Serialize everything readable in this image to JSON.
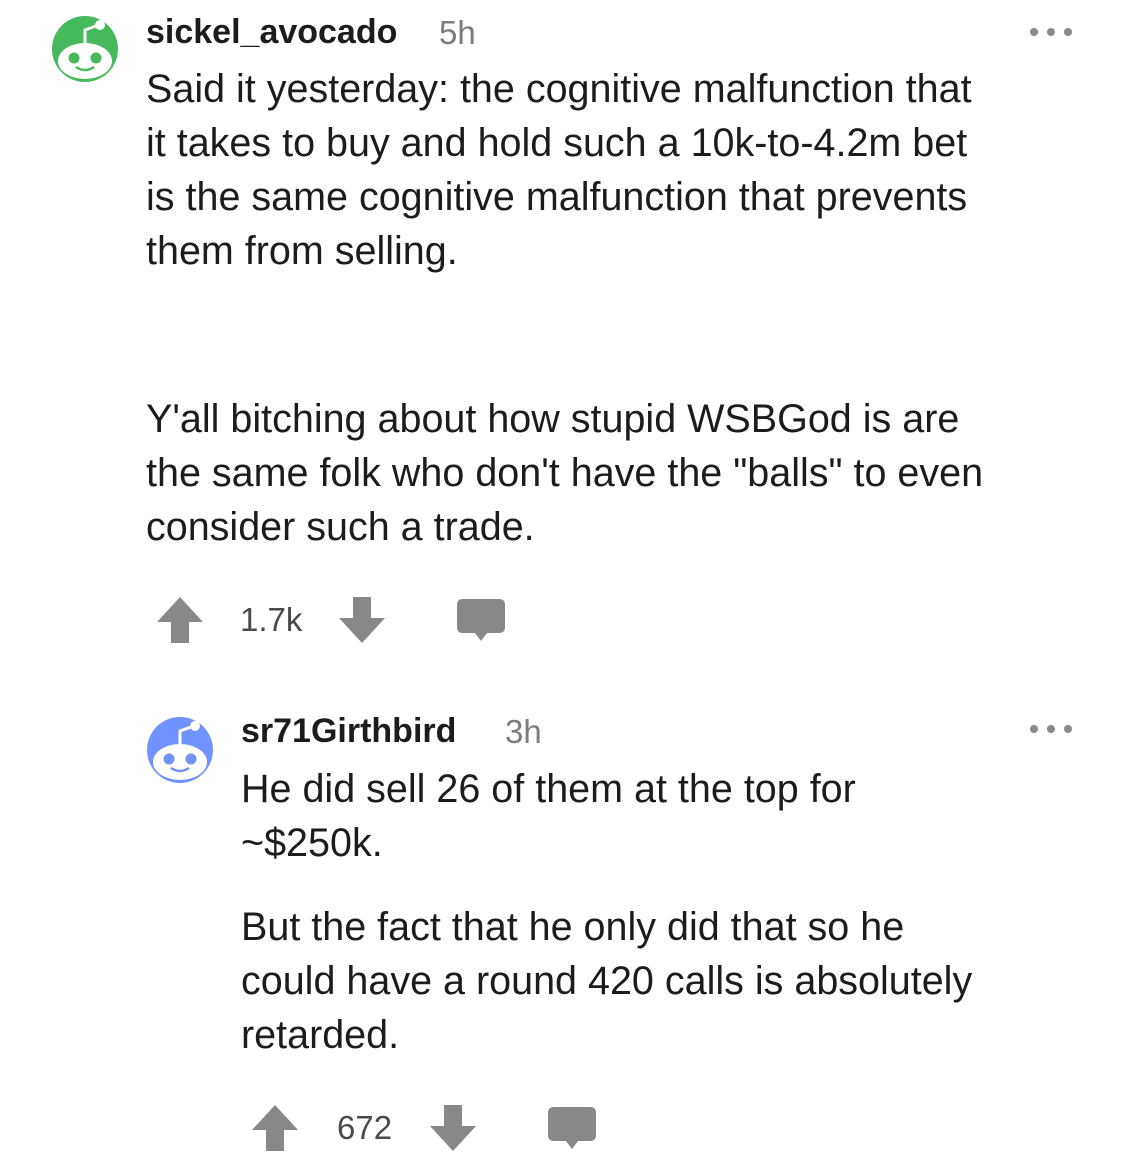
{
  "comments": [
    {
      "username": "sickel_avocado",
      "age": "5h",
      "avatar_color": "#46b95c",
      "paragraphs": [
        [
          "Said it yesterday: the cognitive malfunction that",
          "it takes to buy and hold such a 10k-to-4.2m bet",
          "is the same cognitive malfunction that prevents",
          "them from selling."
        ],
        [
          "Y'all bitching about how stupid WSBGod is are",
          "the same folk who don't have the \"balls\" to even",
          "consider such a trade."
        ]
      ],
      "vote_count": "1.7k"
    },
    {
      "username": "sr71Girthbird",
      "age": "3h",
      "avatar_color": "#7193ff",
      "paragraphs": [
        [
          "He did sell 26 of them at the top for",
          "~$250k."
        ],
        [
          "But the fact that he only did that so he",
          "could have a round 420 calls is absolutely",
          "retarded."
        ]
      ],
      "vote_count": "672"
    }
  ],
  "icons": {
    "upvote": "upvote-arrow-icon",
    "downvote": "downvote-arrow-icon",
    "reply": "reply-bubble-icon",
    "more": "more-options-icon"
  },
  "colors": {
    "icon_gray": "#888888",
    "meta_gray": "#7c7c7c"
  }
}
